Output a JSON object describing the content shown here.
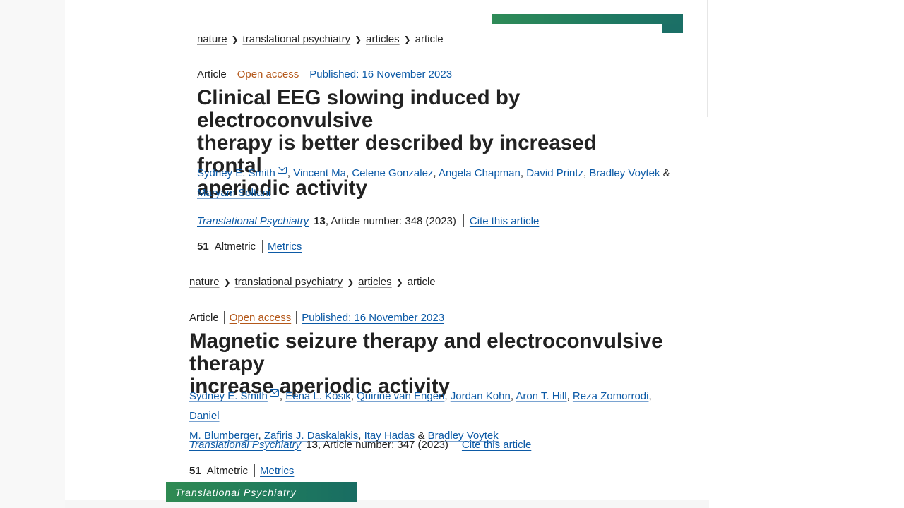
{
  "articles": [
    {
      "breadcrumb": [
        "nature",
        "translational psychiatry",
        "articles",
        "article"
      ],
      "type": "Article",
      "open_access": "Open access",
      "published": "Published: 16 November 2023",
      "title_lines": [
        "Clinical EEG slowing induced by electroconvulsive",
        "therapy is better described by increased frontal",
        "aperiodic activity"
      ],
      "authors_line1": [
        "Sydney E. Smith",
        "Vincent Ma",
        "Celene Gonzalez",
        "Angela Chapman",
        "David Printz",
        "Bradley Voytek"
      ],
      "authors_line2": [
        "Maryam Soltani"
      ],
      "journal": "Translational Psychiatry",
      "volume": "13",
      "article_number": ", Article number: 348 (2023)",
      "cite": "Cite this article",
      "altmetric_score": "51",
      "altmetric_label": "Altmetric",
      "metrics": "Metrics"
    },
    {
      "breadcrumb": [
        "nature",
        "translational psychiatry",
        "articles",
        "article"
      ],
      "type": "Article",
      "open_access": "Open access",
      "published": "Published: 16 November 2023",
      "title_lines": [
        "Magnetic seizure therapy and electroconvulsive therapy",
        "increase aperiodic activity"
      ],
      "authors_line1": [
        "Sydney E. Smith",
        "Eena L. Kosik",
        "Quirine van Engen",
        "Jordan Kohn",
        "Aron T. Hill",
        "Reza Zomorrodi",
        "Daniel"
      ],
      "authors_line2": [
        "M. Blumberger",
        "Zafiris J. Daskalakis",
        "Itay Hadas",
        "Bradley Voytek"
      ],
      "journal": "Translational Psychiatry",
      "volume": "13",
      "article_number": ", Article number: 347 (2023)",
      "cite": "Cite this article",
      "altmetric_score": "51",
      "altmetric_label": "Altmetric",
      "metrics": "Metrics"
    }
  ],
  "punct": {
    "comma": ",",
    "amp": "&"
  },
  "footer_banner": "Translational Psychiatry"
}
